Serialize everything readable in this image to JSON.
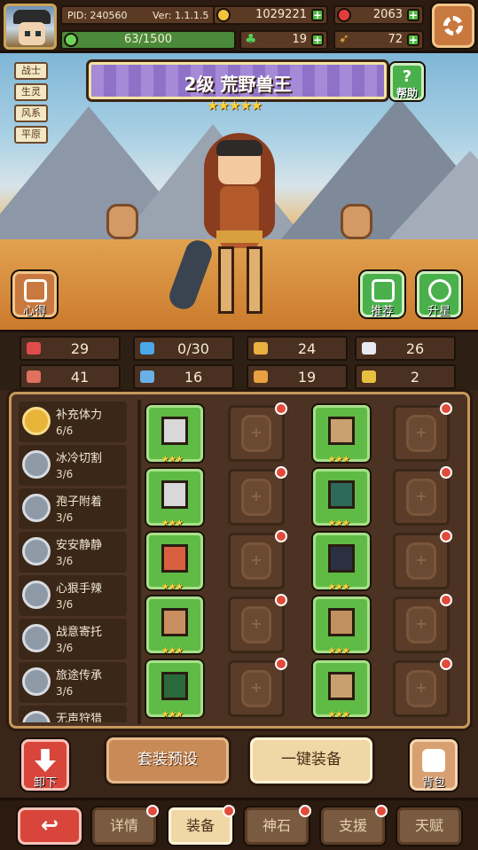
{
  "header": {
    "pid": "PID: 240560",
    "version": "Ver: 1.1.1.5",
    "gold": "1029221",
    "gems": "2063",
    "xp": "63/1500",
    "clover": "19",
    "feather": "72"
  },
  "hero": {
    "title": "2级 荒野兽王",
    "stars": "★★★★★",
    "tags": [
      "战士",
      "生灵",
      "风系",
      "平原"
    ],
    "help_label": "帮助",
    "notes_label": "心得",
    "recommend_label": "推荐",
    "upgrade_label": "升星"
  },
  "stats": [
    {
      "icon": "heart-icon",
      "value": "29",
      "color": "#e04c4c"
    },
    {
      "icon": "water-drop-icon",
      "value": "0/30",
      "color": "#4aa8e8"
    },
    {
      "icon": "shield-icon",
      "value": "24",
      "color": "#e8b040"
    },
    {
      "icon": "wing-icon",
      "value": "26",
      "color": "#e8e8f0"
    },
    {
      "icon": "attack-icon",
      "value": "41",
      "color": "#e07060"
    },
    {
      "icon": "book-icon",
      "value": "16",
      "color": "#6ab0e8"
    },
    {
      "icon": "boot-icon",
      "value": "19",
      "color": "#e8a040"
    },
    {
      "icon": "horseshoe-icon",
      "value": "2",
      "color": "#e8c040"
    }
  ],
  "sets": [
    {
      "name": "补充体力",
      "count": "6/6",
      "active": true
    },
    {
      "name": "冰冷切割",
      "count": "3/6",
      "active": false
    },
    {
      "name": "孢子附着",
      "count": "3/6",
      "active": false
    },
    {
      "name": "安安静静",
      "count": "3/6",
      "active": false
    },
    {
      "name": "心狠手辣",
      "count": "3/6",
      "active": false
    },
    {
      "name": "战意寄托",
      "count": "3/6",
      "active": false
    },
    {
      "name": "旅途传承",
      "count": "3/6",
      "active": false
    },
    {
      "name": "无声狩猎",
      "count": "",
      "active": false
    }
  ],
  "slot_stars": "★★★",
  "slot_plus": "+",
  "actions": {
    "unequip": "卸下",
    "preset": "套装预设",
    "equip_all": "一键装备",
    "bag": "背包"
  },
  "nav": {
    "back": "↩",
    "tabs": [
      {
        "label": "详情",
        "active": false,
        "badge": true
      },
      {
        "label": "装备",
        "active": true,
        "badge": true
      },
      {
        "label": "神石",
        "active": false,
        "badge": true
      },
      {
        "label": "支援",
        "active": false,
        "badge": true
      },
      {
        "label": "天赋",
        "active": false,
        "badge": false
      }
    ]
  }
}
